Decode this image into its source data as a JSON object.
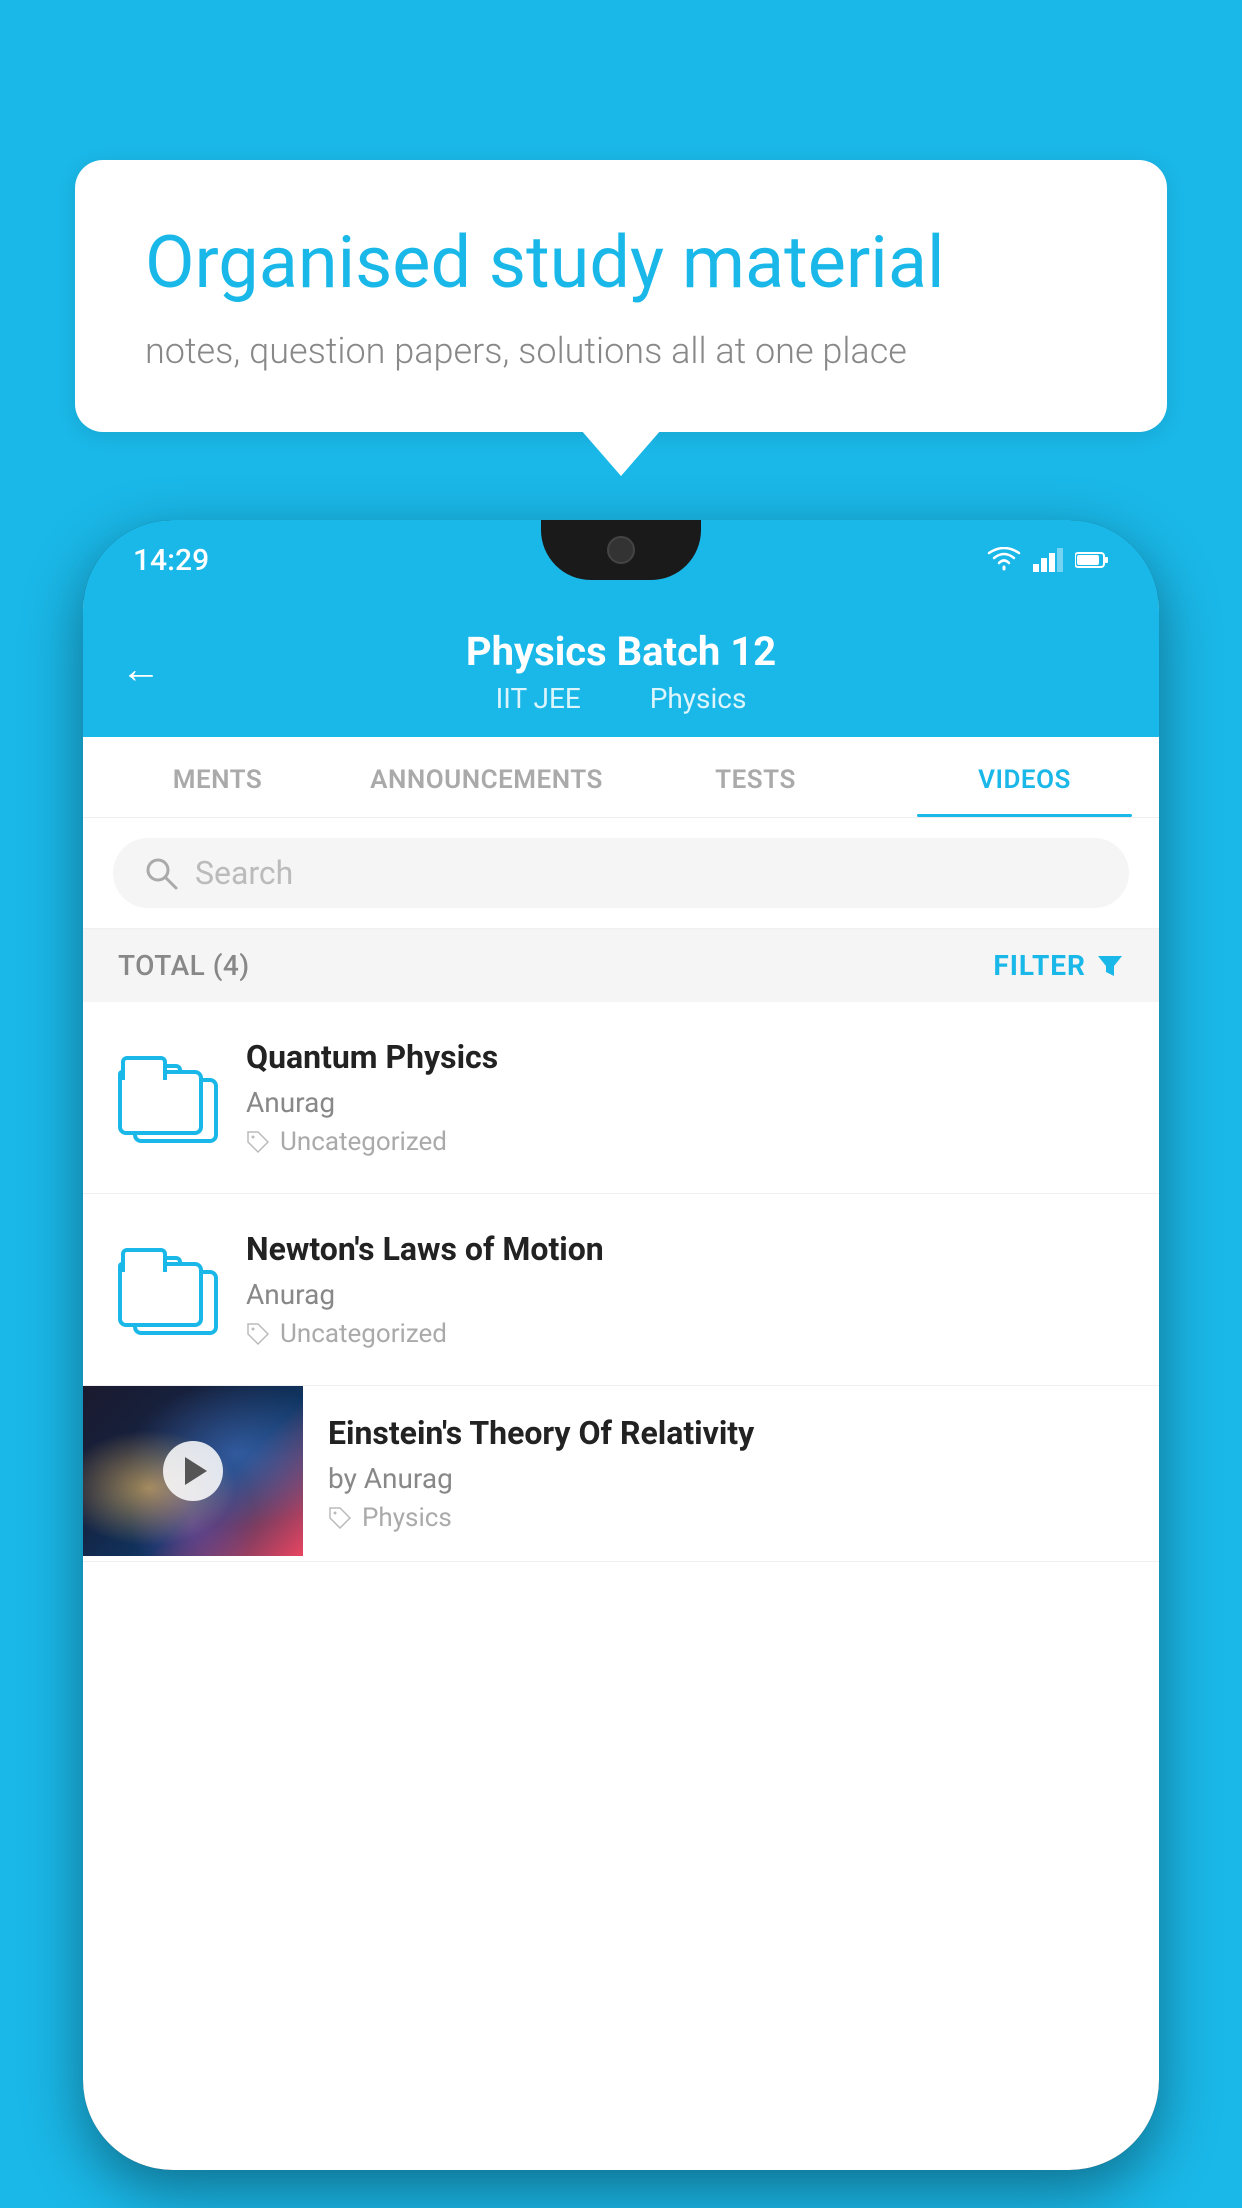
{
  "background_color": "#1ab8e8",
  "bubble": {
    "title": "Organised study material",
    "subtitle": "notes, question papers, solutions all at one place"
  },
  "phone": {
    "status_bar": {
      "time": "14:29"
    },
    "header": {
      "back_label": "←",
      "title": "Physics Batch 12",
      "tag1": "IIT JEE",
      "tag2": "Physics"
    },
    "tabs": [
      {
        "label": "MENTS",
        "active": false
      },
      {
        "label": "ANNOUNCEMENTS",
        "active": false
      },
      {
        "label": "TESTS",
        "active": false
      },
      {
        "label": "VIDEOS",
        "active": true
      }
    ],
    "search": {
      "placeholder": "Search"
    },
    "filter_bar": {
      "total_label": "TOTAL (4)",
      "filter_label": "FILTER"
    },
    "videos": [
      {
        "title": "Quantum Physics",
        "author": "Anurag",
        "tag": "Uncategorized",
        "has_thumb": false
      },
      {
        "title": "Newton's Laws of Motion",
        "author": "Anurag",
        "tag": "Uncategorized",
        "has_thumb": false
      },
      {
        "title": "Einstein's Theory Of Relativity",
        "author": "by Anurag",
        "tag": "Physics",
        "has_thumb": true
      }
    ]
  }
}
